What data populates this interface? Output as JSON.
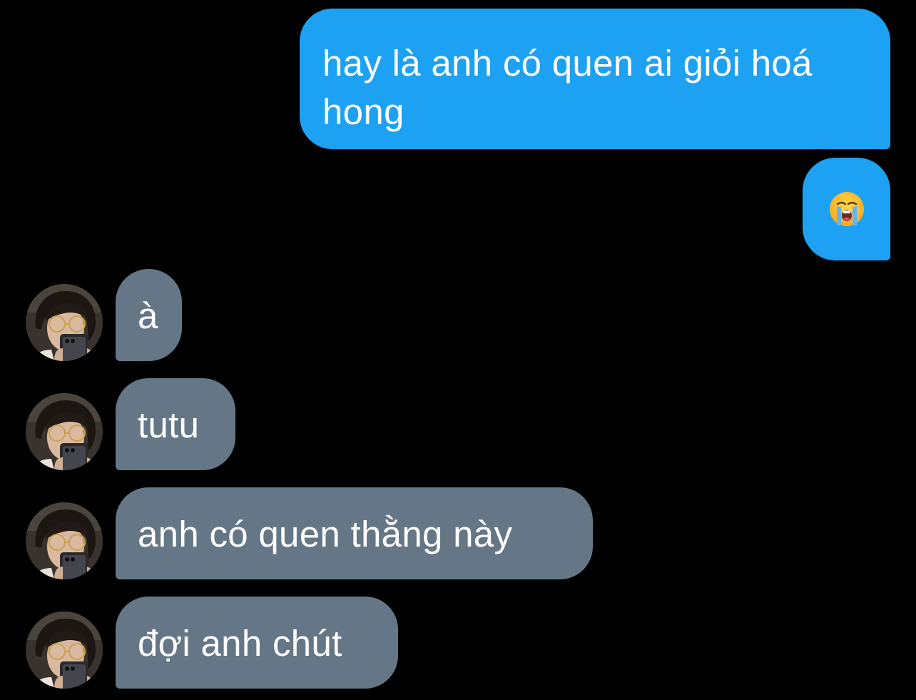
{
  "colors": {
    "background": "#000000",
    "outgoing_bubble": "#1da1f2",
    "incoming_bubble": "#657786",
    "text": "#ffffff"
  },
  "messages": {
    "outgoing": [
      {
        "text": "hay là anh có quen ai giỏi hoá hong"
      },
      {
        "icon": "loudly-crying-face-emoji"
      }
    ],
    "incoming": [
      {
        "text": "à",
        "avatar": "contact-avatar"
      },
      {
        "text": "tutu",
        "avatar": "contact-avatar"
      },
      {
        "text": "anh có quen thằng này",
        "avatar": "contact-avatar"
      },
      {
        "text": "đợi anh chút",
        "avatar": "contact-avatar"
      }
    ]
  }
}
